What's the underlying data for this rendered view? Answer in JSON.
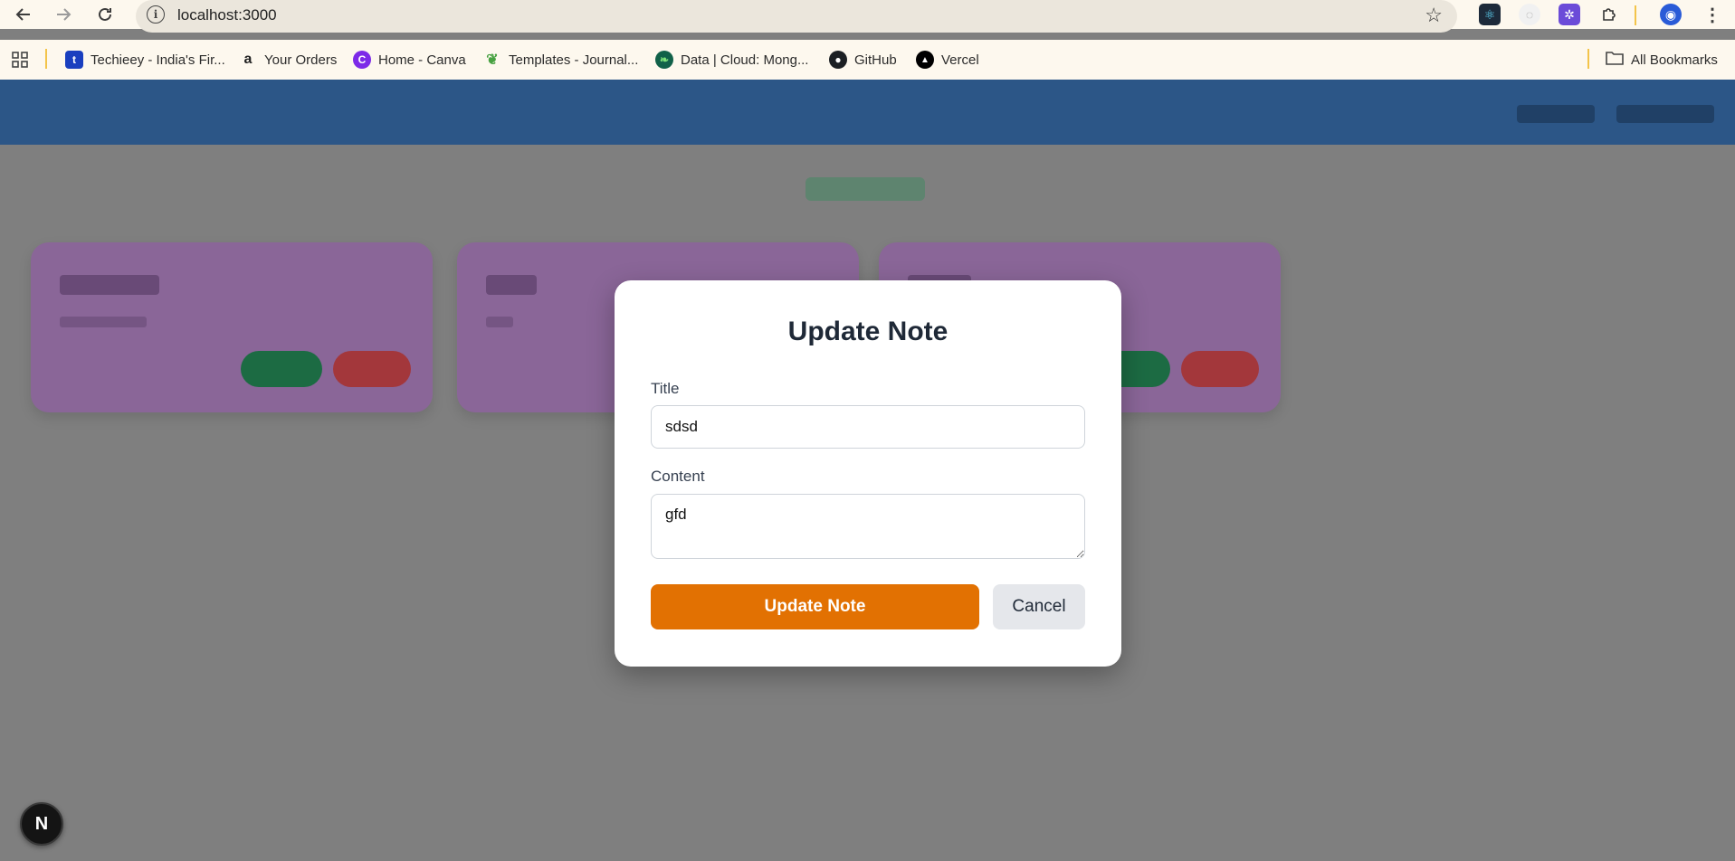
{
  "browser": {
    "url": "localhost:3000",
    "bookmarks": [
      {
        "label": "Techieey - India's Fir...",
        "icon": "techieey-icon",
        "color": "#1a3fbf"
      },
      {
        "label": "Your Orders",
        "icon": "amazon-icon",
        "color": "#222222"
      },
      {
        "label": "Home - Canva",
        "icon": "canva-icon",
        "color": "#7d2ae8"
      },
      {
        "label": "Templates - Journal...",
        "icon": "overleaf-icon",
        "color": "#47a141"
      },
      {
        "label": "Data | Cloud: Mong...",
        "icon": "mongodb-icon",
        "color": "#116149"
      },
      {
        "label": "GitHub",
        "icon": "github-icon",
        "color": "#1b1f23"
      },
      {
        "label": "Vercel",
        "icon": "vercel-icon",
        "color": "#000000"
      }
    ],
    "all_bookmarks": "All Bookmarks"
  },
  "modal": {
    "title": "Update Note",
    "title_label": "Title",
    "title_value": "sdsd",
    "content_label": "Content",
    "content_value": "gfd",
    "update_button": "Update Note",
    "cancel_button": "Cancel"
  },
  "colors": {
    "accent": "#e27102",
    "header": "#2c5687",
    "overlay": "#7f7f7f"
  },
  "badge": {
    "label": "N"
  }
}
